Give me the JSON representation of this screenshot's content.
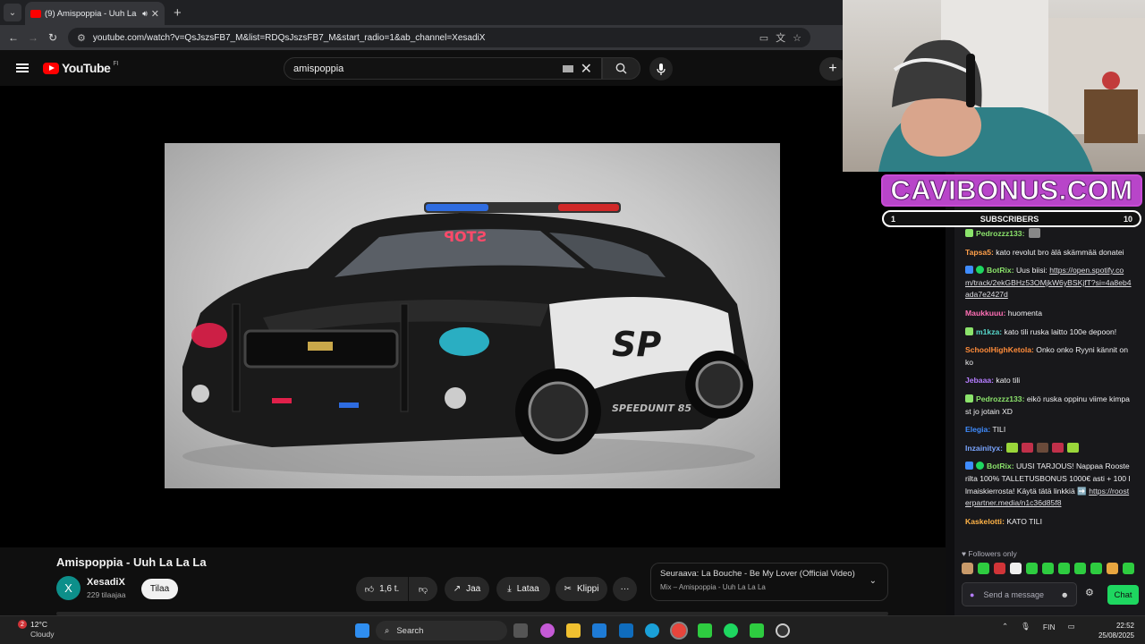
{
  "browser": {
    "tab_title": "(9) Amispoppia - Uuh La La",
    "tab_close": "✕",
    "new_tab": "+",
    "url": "youtube.com/watch?v=QsJszsFB7_M&list=RDQsJszsFB7_M&start_radio=1&ab_channel=XesadiX"
  },
  "youtube": {
    "logo": "YouTube",
    "country": "FI",
    "search_value": "amispoppia",
    "video_title": "Amispoppia - Uuh La La La",
    "channel_initial": "X",
    "channel_name": "XesadiX",
    "subscribers": "229 tilaajaa",
    "subscribe_label": "Tilaa",
    "likes": "1,6 t.",
    "share_label": "Jaa",
    "download_label": "Lataa",
    "clip_label": "Klippi",
    "more_label": "···",
    "next_prefix": "Seuraava:",
    "next_title": "La Bouche - Be My Lover (Official Video)",
    "next_mix": "Mix – Amispoppia - Uuh La La La"
  },
  "overlay": {
    "brand": "CAVIBONUS.COM",
    "sub_goal_left": "1",
    "sub_goal_label": "SUBSCRIBERS",
    "sub_goal_right": "10"
  },
  "video_frame": {
    "plate_text": "STOP",
    "door_text": "SP",
    "side_text": "SPEEDUNIT 85"
  },
  "chat": {
    "messages": [
      {
        "user": "Pedrozzz133:",
        "color": "#8be36b",
        "text": ""
      },
      {
        "user": "Tapsa5:",
        "color": "#ff9f4a",
        "text": "kato revolut bro älä skämmää donatei"
      },
      {
        "user": "BotRix:",
        "color": "#8be36b",
        "text": "Uus biisi: ",
        "link": "https://open.spotify.com/track/2ekGBHz53OMjkW6yBSKjfT?si=4a8eb4ada7e2427d"
      },
      {
        "user": "Maukkuuu:",
        "color": "#ff6fb5",
        "text": "huomenta"
      },
      {
        "user": "m1kza:",
        "color": "#56d6c9",
        "text": "kato tili ruska laitto 100e depoon!"
      },
      {
        "user": "SchoolHighKetola:",
        "color": "#ff8c3a",
        "text": "Onko onko Ryyni kännit onko"
      },
      {
        "user": "Jebaaa:",
        "color": "#b57dff",
        "text": "kato tili"
      },
      {
        "user": "Pedrozzz133:",
        "color": "#8be36b",
        "text": "eikö ruska oppinu viime kimpast jo jotain XD"
      },
      {
        "user": "Elegia:",
        "color": "#3f8cff",
        "text": "TILI"
      },
      {
        "user": "Inzainityx:",
        "color": "#7aa5ff",
        "text": ""
      },
      {
        "user": "BotRix:",
        "color": "#8be36b",
        "text": "UUSI TARJOUS! Nappaa Roosterilta 100% TALLETUSBONUS 1000€ asti + 100 Ilmaiskierrosta! Käytä tätä linkkiä ➡️ ",
        "link": "https://roosterpartner.media/n1c36d85f8"
      },
      {
        "user": "Kaskelotti:",
        "color": "#ffb347",
        "text": "KATO TILI"
      }
    ],
    "followers_only": "Followers only",
    "send_placeholder": "Send a message",
    "chat_button": "Chat"
  },
  "taskbar": {
    "weather_temp": "12°C",
    "weather_desc": "Cloudy",
    "weather_badge": "2",
    "search_label": "Search",
    "lang": "FIN",
    "time": "22:52",
    "date": "25/08/2025"
  }
}
